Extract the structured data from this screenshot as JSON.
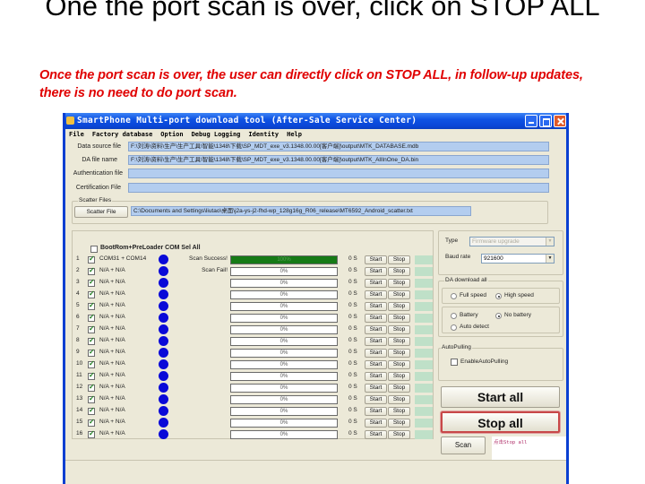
{
  "slide": {
    "title": "One the port scan is over, click on STOP ALL",
    "subtitle": "Once the port scan is over,  the user can directly click on STOP ALL, in follow-up updates, there is no need to do port scan."
  },
  "window": {
    "title": "SmartPhone Multi-port download tool (After-Sale Service Center)",
    "menu": [
      "File",
      "Factory database",
      "Option",
      "Debug Logging",
      "Identity",
      "Help"
    ]
  },
  "files": {
    "data_source_label": "Data source file",
    "data_source_value": "F:\\刘涛\\资料\\生产\\生产工具\\智能\\1348\\下载\\SP_MDT_exe_v3.1348.00.00[客户端]\\output\\MTK_DATABASE.mdb",
    "da_label": "DA file name",
    "da_value": "F:\\刘涛\\资料\\生产\\生产工具\\智能\\1348\\下载\\SP_MDT_exe_v3.1348.00.00[客户端]\\output\\MTK_AllInOne_DA.bin",
    "auth_label": "Authentication file",
    "auth_value": "",
    "cert_label": "Certification File",
    "cert_value": "",
    "scatter_group": "Scatter Files",
    "scatter_button": "Scatter File",
    "scatter_value": "C:\\Documents and Settings\\liutao\\桌面\\j2a-ys-j2-fhd-wp_128g16g_R06_release\\MT6592_Android_scatter.txt"
  },
  "ports": {
    "select_all_label": "BootRom+PreLoader COM Sel All",
    "select_all_checked": false,
    "start_label": "Start",
    "stop_label": "Stop",
    "rows": [
      {
        "index": "1",
        "checked": true,
        "com": "COM31 + COM14",
        "status": "Scan Success!",
        "progress": 100,
        "progress_text": "100%",
        "time": "0 S"
      },
      {
        "index": "2",
        "checked": true,
        "com": "N/A + N/A",
        "status": "Scan Fail!",
        "progress": 0,
        "progress_text": "0%",
        "time": "0 S"
      },
      {
        "index": "3",
        "checked": true,
        "com": "N/A + N/A",
        "status": "",
        "progress": 0,
        "progress_text": "0%",
        "time": "0 S"
      },
      {
        "index": "4",
        "checked": true,
        "com": "N/A + N/A",
        "status": "",
        "progress": 0,
        "progress_text": "0%",
        "time": "0 S"
      },
      {
        "index": "5",
        "checked": true,
        "com": "N/A + N/A",
        "status": "",
        "progress": 0,
        "progress_text": "0%",
        "time": "0 S"
      },
      {
        "index": "6",
        "checked": true,
        "com": "N/A + N/A",
        "status": "",
        "progress": 0,
        "progress_text": "0%",
        "time": "0 S"
      },
      {
        "index": "7",
        "checked": true,
        "com": "N/A + N/A",
        "status": "",
        "progress": 0,
        "progress_text": "0%",
        "time": "0 S"
      },
      {
        "index": "8",
        "checked": true,
        "com": "N/A + N/A",
        "status": "",
        "progress": 0,
        "progress_text": "0%",
        "time": "0 S"
      },
      {
        "index": "9",
        "checked": true,
        "com": "N/A + N/A",
        "status": "",
        "progress": 0,
        "progress_text": "0%",
        "time": "0 S"
      },
      {
        "index": "10",
        "checked": true,
        "com": "N/A + N/A",
        "status": "",
        "progress": 0,
        "progress_text": "0%",
        "time": "0 S"
      },
      {
        "index": "11",
        "checked": true,
        "com": "N/A + N/A",
        "status": "",
        "progress": 0,
        "progress_text": "0%",
        "time": "0 S"
      },
      {
        "index": "12",
        "checked": true,
        "com": "N/A + N/A",
        "status": "",
        "progress": 0,
        "progress_text": "0%",
        "time": "0 S"
      },
      {
        "index": "13",
        "checked": true,
        "com": "N/A + N/A",
        "status": "",
        "progress": 0,
        "progress_text": "0%",
        "time": "0 S"
      },
      {
        "index": "14",
        "checked": true,
        "com": "N/A + N/A",
        "status": "",
        "progress": 0,
        "progress_text": "0%",
        "time": "0 S"
      },
      {
        "index": "15",
        "checked": true,
        "com": "N/A + N/A",
        "status": "",
        "progress": 0,
        "progress_text": "0%",
        "time": "0 S"
      },
      {
        "index": "16",
        "checked": true,
        "com": "N/A + N/A",
        "status": "",
        "progress": 0,
        "progress_text": "0%",
        "time": "0 S"
      }
    ]
  },
  "settings": {
    "type_label": "Type",
    "type_value": "Firmware upgrade",
    "baud_label": "Baud rate",
    "baud_value": "921600",
    "da_group": "DA download all",
    "full_speed": "Full speed",
    "high_speed": "High speed",
    "speed_selected": "High speed",
    "battery": "Battery",
    "no_battery": "No battery",
    "auto_detect": "Auto detect",
    "battery_selected": "No battery",
    "autopulling_group": "AutoPulling",
    "enable_autopulling": "EnableAutoPulling",
    "autopulling_checked": false
  },
  "actions": {
    "start_all": "Start all",
    "stop_all": "Stop all",
    "scan": "Scan",
    "note": "点击Stop all"
  },
  "colors": {
    "accent_red": "#e00000",
    "led_blue": "#0a0ad8",
    "progress_green": "#167a16",
    "highlight": "#c84848"
  }
}
